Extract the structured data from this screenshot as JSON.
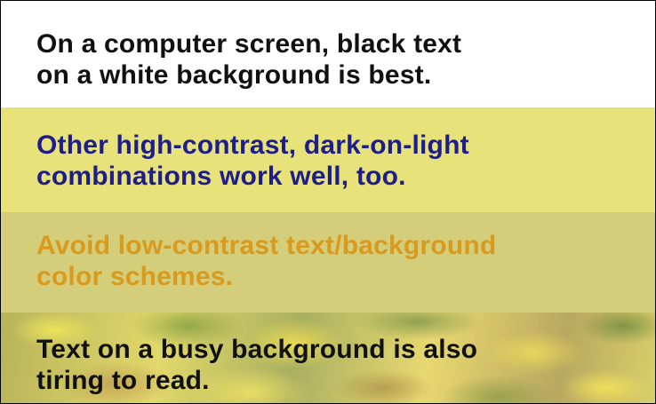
{
  "bands": [
    {
      "line1": "On a computer screen, black text",
      "line2": "on a white background is best.",
      "background": "#ffffff",
      "text_color": "#111111"
    },
    {
      "line1": "Other high-contrast, dark-on-light",
      "line2": "combinations work well, too.",
      "background": "#e8e27b",
      "text_color": "#1e1e8a"
    },
    {
      "line1": "Avoid low-contrast text/background",
      "line2": "color schemes.",
      "background": "#d4cd7a",
      "text_color": "#d99a1e"
    },
    {
      "line1": "Text on a busy background is also",
      "line2": "tiring to read.",
      "background": "busy mottled yellow-green pattern",
      "text_color": "#111111"
    }
  ]
}
